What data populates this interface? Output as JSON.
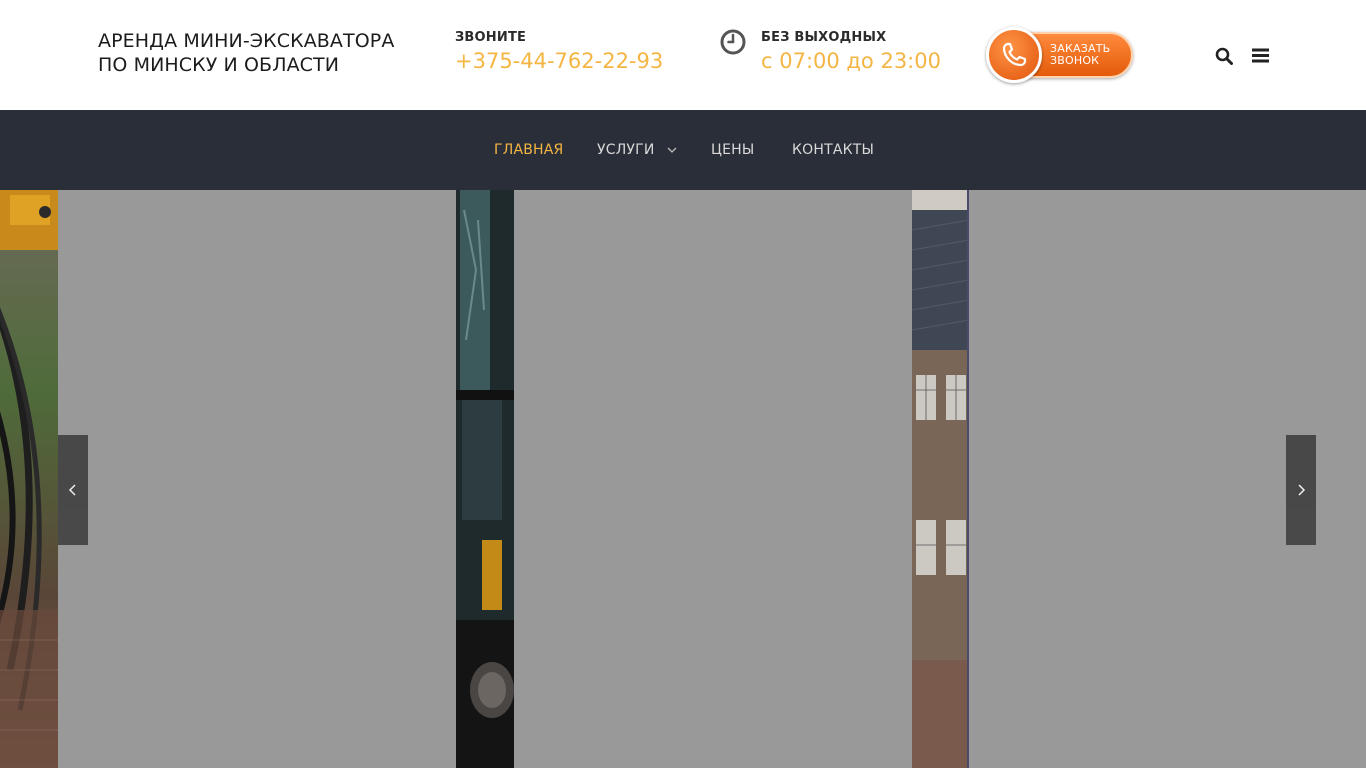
{
  "header": {
    "logo_line1": "АРЕНДА МИНИ-ЭКСКАВАТОРА",
    "logo_line2": "ПО МИНСКУ И ОБЛАСТИ",
    "phone_label": "ЗВОНИТЕ",
    "phone_value": "+375-44-762-22-93",
    "hours_label": "БЕЗ ВЫХОДНЫХ",
    "hours_value": "с 07:00 до 23:00",
    "callback_line1": "ЗАКАЗАТЬ",
    "callback_line2": "ЗВОНОК"
  },
  "nav": {
    "items": [
      {
        "label": "ГЛАВНАЯ",
        "active": true
      },
      {
        "label": "УСЛУГИ",
        "has_dropdown": true
      },
      {
        "label": "ЦЕНЫ"
      },
      {
        "label": "КОНТАКТЫ"
      }
    ]
  },
  "icons": {
    "clock": "clock-icon",
    "callback": "phone-icon",
    "search": "search-icon",
    "menu": "menu-icon",
    "prev": "chevron-left-icon",
    "next": "chevron-right-icon"
  },
  "colors": {
    "accent": "#f4b543",
    "nav_bg": "#2a2e38",
    "overlay": "#999999",
    "button_orange": "#f07020"
  }
}
